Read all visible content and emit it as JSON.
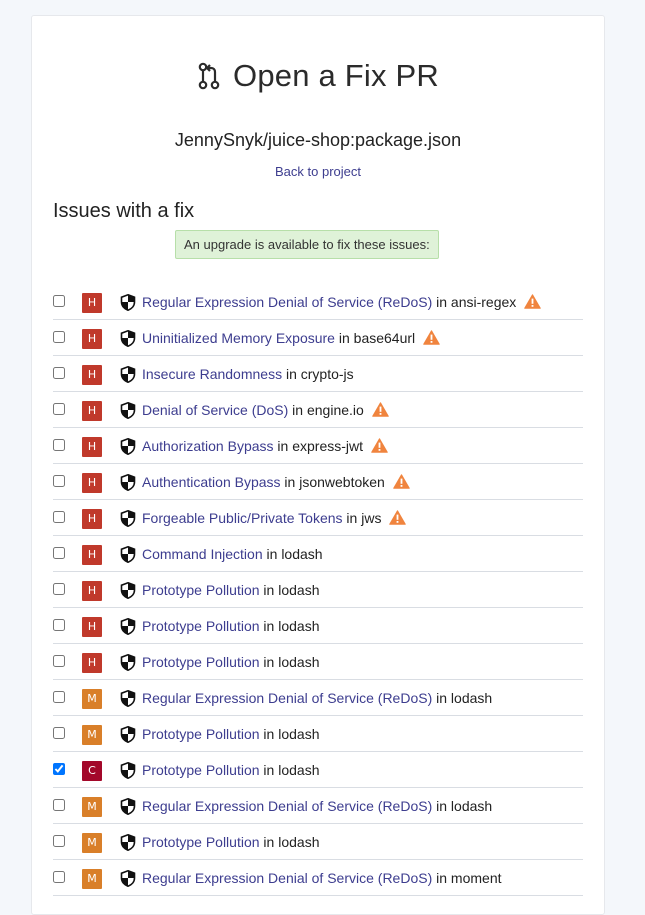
{
  "header": {
    "title": "Open a Fix PR",
    "file_path": "JennySnyk/juice-shop:package.json",
    "back_link": "Back to project"
  },
  "section": {
    "heading": "Issues with a fix",
    "upgrade_note": "An upgrade is available to fix these issues:"
  },
  "colors": {
    "high": "#c0392b",
    "medium": "#d97f29",
    "critical": "#a3082a",
    "link": "#3d3d8f",
    "warning": "#f0843e"
  },
  "issues": [
    {
      "severity": "H",
      "title": "Regular Expression Denial of Service (ReDoS)",
      "in": "in",
      "package": "ansi-regex",
      "warning": true,
      "checked": false
    },
    {
      "severity": "H",
      "title": "Uninitialized Memory Exposure",
      "in": "in",
      "package": "base64url",
      "warning": true,
      "checked": false
    },
    {
      "severity": "H",
      "title": "Insecure Randomness",
      "in": "in",
      "package": "crypto-js",
      "warning": false,
      "checked": false
    },
    {
      "severity": "H",
      "title": "Denial of Service (DoS)",
      "in": "in",
      "package": "engine.io",
      "warning": true,
      "checked": false
    },
    {
      "severity": "H",
      "title": "Authorization Bypass",
      "in": "in",
      "package": "express-jwt",
      "warning": true,
      "checked": false
    },
    {
      "severity": "H",
      "title": "Authentication Bypass",
      "in": "in",
      "package": "jsonwebtoken",
      "warning": true,
      "checked": false
    },
    {
      "severity": "H",
      "title": "Forgeable Public/Private Tokens",
      "in": "in",
      "package": "jws",
      "warning": true,
      "checked": false
    },
    {
      "severity": "H",
      "title": "Command Injection",
      "in": "in",
      "package": "lodash",
      "warning": false,
      "checked": false
    },
    {
      "severity": "H",
      "title": "Prototype Pollution",
      "in": "in",
      "package": "lodash",
      "warning": false,
      "checked": false
    },
    {
      "severity": "H",
      "title": "Prototype Pollution",
      "in": "in",
      "package": "lodash",
      "warning": false,
      "checked": false
    },
    {
      "severity": "H",
      "title": "Prototype Pollution",
      "in": "in",
      "package": "lodash",
      "warning": false,
      "checked": false
    },
    {
      "severity": "M",
      "title": "Regular Expression Denial of Service (ReDoS)",
      "in": "in",
      "package": "lodash",
      "warning": false,
      "checked": false
    },
    {
      "severity": "M",
      "title": "Prototype Pollution",
      "in": "in",
      "package": "lodash",
      "warning": false,
      "checked": false
    },
    {
      "severity": "C",
      "title": "Prototype Pollution",
      "in": "in",
      "package": "lodash",
      "warning": false,
      "checked": true
    },
    {
      "severity": "M",
      "title": "Regular Expression Denial of Service (ReDoS)",
      "in": "in",
      "package": "lodash",
      "warning": false,
      "checked": false
    },
    {
      "severity": "M",
      "title": "Prototype Pollution",
      "in": "in",
      "package": "lodash",
      "warning": false,
      "checked": false
    },
    {
      "severity": "M",
      "title": "Regular Expression Denial of Service (ReDoS)",
      "in": "in",
      "package": "moment",
      "warning": false,
      "checked": false
    }
  ]
}
